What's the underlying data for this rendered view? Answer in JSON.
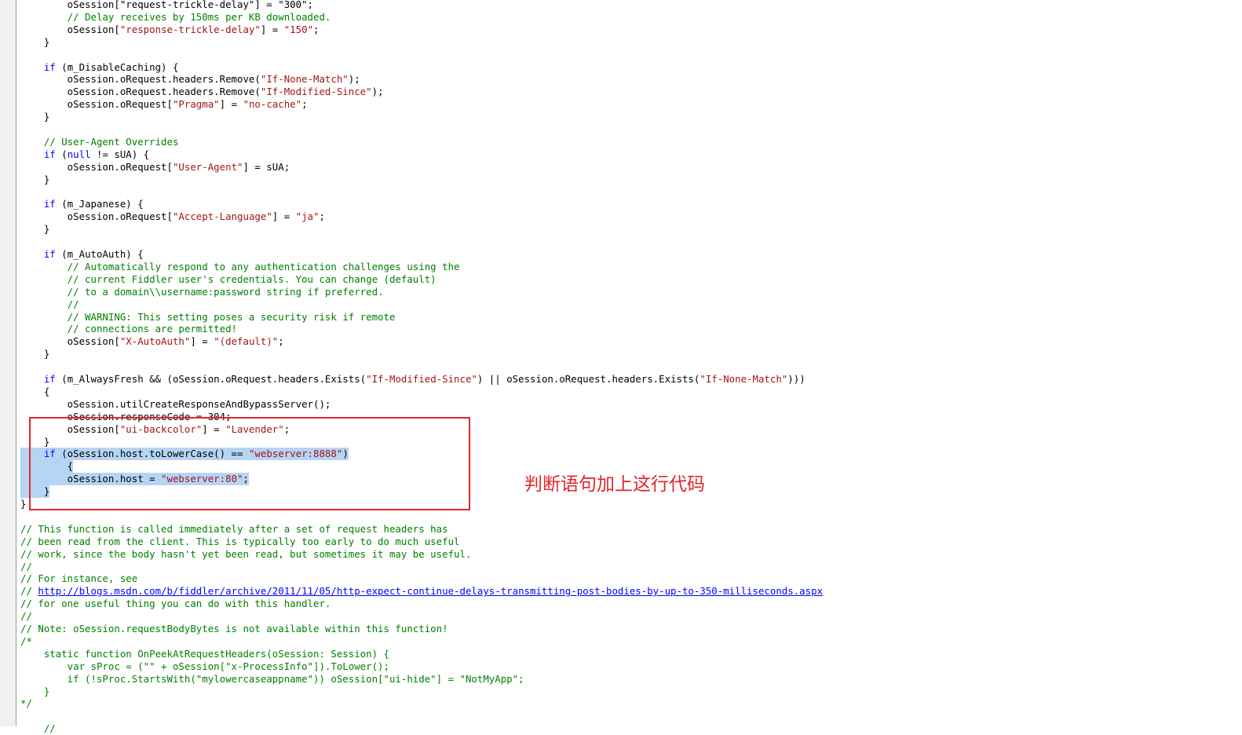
{
  "annotation": {
    "text": "判断语句加上这行代码",
    "box_color": "#e0262b"
  },
  "colors": {
    "keyword": "#0000ff",
    "string": "#a31515",
    "comment": "#008000",
    "selection": "#b6d4f4"
  },
  "code_lines": [
    {
      "segs": [
        [
          "p",
          "        oSession[\"request-trickle-delay\"] = \"300\";"
        ]
      ]
    },
    {
      "segs": [
        [
          "c",
          "        // Delay receives by 150ms per KB downloaded."
        ]
      ]
    },
    {
      "segs": [
        [
          "p",
          "        oSession["
        ],
        [
          "s",
          "\"response-trickle-delay\""
        ],
        [
          "p",
          "] = "
        ],
        [
          "s",
          "\"150\""
        ],
        [
          "p",
          ";"
        ]
      ]
    },
    {
      "segs": [
        [
          "p",
          "    }"
        ]
      ]
    },
    {
      "segs": []
    },
    {
      "segs": [
        [
          "k",
          "    if"
        ],
        [
          "p",
          " (m_DisableCaching) {"
        ]
      ]
    },
    {
      "segs": [
        [
          "p",
          "        oSession.oRequest.headers.Remove("
        ],
        [
          "s",
          "\"If-None-Match\""
        ],
        [
          "p",
          ");"
        ]
      ]
    },
    {
      "segs": [
        [
          "p",
          "        oSession.oRequest.headers.Remove("
        ],
        [
          "s",
          "\"If-Modified-Since\""
        ],
        [
          "p",
          ");"
        ]
      ]
    },
    {
      "segs": [
        [
          "p",
          "        oSession.oRequest["
        ],
        [
          "s",
          "\"Pragma\""
        ],
        [
          "p",
          "] = "
        ],
        [
          "s",
          "\"no-cache\""
        ],
        [
          "p",
          ";"
        ]
      ]
    },
    {
      "segs": [
        [
          "p",
          "    }"
        ]
      ]
    },
    {
      "segs": []
    },
    {
      "segs": [
        [
          "c",
          "    // User-Agent Overrides"
        ]
      ]
    },
    {
      "segs": [
        [
          "k",
          "    if"
        ],
        [
          "p",
          " ("
        ],
        [
          "k",
          "null"
        ],
        [
          "p",
          " != sUA) {"
        ]
      ]
    },
    {
      "segs": [
        [
          "p",
          "        oSession.oRequest["
        ],
        [
          "s",
          "\"User-Agent\""
        ],
        [
          "p",
          "] = sUA;"
        ]
      ]
    },
    {
      "segs": [
        [
          "p",
          "    }"
        ]
      ]
    },
    {
      "segs": []
    },
    {
      "segs": [
        [
          "k",
          "    if"
        ],
        [
          "p",
          " (m_Japanese) {"
        ]
      ]
    },
    {
      "segs": [
        [
          "p",
          "        oSession.oRequest["
        ],
        [
          "s",
          "\"Accept-Language\""
        ],
        [
          "p",
          "] = "
        ],
        [
          "s",
          "\"ja\""
        ],
        [
          "p",
          ";"
        ]
      ]
    },
    {
      "segs": [
        [
          "p",
          "    }"
        ]
      ]
    },
    {
      "segs": []
    },
    {
      "segs": [
        [
          "k",
          "    if"
        ],
        [
          "p",
          " (m_AutoAuth) {"
        ]
      ]
    },
    {
      "segs": [
        [
          "c",
          "        // Automatically respond to any authentication challenges using the"
        ]
      ]
    },
    {
      "segs": [
        [
          "c",
          "        // current Fiddler user's credentials. You can change (default)"
        ]
      ]
    },
    {
      "segs": [
        [
          "c",
          "        // to a domain\\\\username:password string if preferred."
        ]
      ]
    },
    {
      "segs": [
        [
          "c",
          "        //"
        ]
      ]
    },
    {
      "segs": [
        [
          "c",
          "        // WARNING: This setting poses a security risk if remote"
        ]
      ]
    },
    {
      "segs": [
        [
          "c",
          "        // connections are permitted!"
        ]
      ]
    },
    {
      "segs": [
        [
          "p",
          "        oSession["
        ],
        [
          "s",
          "\"X-AutoAuth\""
        ],
        [
          "p",
          "] = "
        ],
        [
          "s",
          "\"(default)\""
        ],
        [
          "p",
          ";"
        ]
      ]
    },
    {
      "segs": [
        [
          "p",
          "    }"
        ]
      ]
    },
    {
      "segs": []
    },
    {
      "segs": [
        [
          "k",
          "    if"
        ],
        [
          "p",
          " (m_AlwaysFresh && (oSession.oRequest.headers.Exists("
        ],
        [
          "s",
          "\"If-Modified-Since\""
        ],
        [
          "p",
          ") || oSession.oRequest.headers.Exists("
        ],
        [
          "s",
          "\"If-None-Match\""
        ],
        [
          "p",
          ")))"
        ]
      ]
    },
    {
      "segs": [
        [
          "p",
          "    {"
        ]
      ]
    },
    {
      "segs": [
        [
          "p",
          "        oSession.utilCreateResponseAndBypassServer();"
        ]
      ]
    },
    {
      "segs": [
        [
          "p",
          "        oSession.responseCode = 304;"
        ]
      ]
    },
    {
      "segs": [
        [
          "p",
          "        oSession["
        ],
        [
          "s",
          "\"ui-backcolor\""
        ],
        [
          "p",
          "] = "
        ],
        [
          "s",
          "\"Lavender\""
        ],
        [
          "p",
          ";"
        ]
      ]
    },
    {
      "segs": [
        [
          "p",
          "    }"
        ]
      ]
    },
    {
      "segs": [
        [
          "p",
          "    "
        ],
        [
          "k",
          "if"
        ],
        [
          "p",
          " (oSession.host.toLowerCase() == "
        ],
        [
          "s",
          "\"webserver:8888\""
        ],
        [
          "p",
          ")"
        ]
      ],
      "sel": true
    },
    {
      "segs": [
        [
          "p",
          "        {"
        ]
      ],
      "sel": true
    },
    {
      "segs": [
        [
          "p",
          "        oSession.host = "
        ],
        [
          "s",
          "\"webserver:80\""
        ],
        [
          "p",
          ";"
        ]
      ],
      "sel": true
    },
    {
      "segs": [
        [
          "p",
          "    }"
        ]
      ],
      "sel": true
    },
    {
      "segs": [
        [
          "p",
          "}"
        ]
      ]
    },
    {
      "segs": []
    },
    {
      "segs": [
        [
          "c",
          "// This function is called immediately after a set of request headers has"
        ]
      ]
    },
    {
      "segs": [
        [
          "c",
          "// been read from the client. This is typically too early to do much useful"
        ]
      ]
    },
    {
      "segs": [
        [
          "c",
          "// work, since the body hasn't yet been read, but sometimes it may be useful."
        ]
      ]
    },
    {
      "segs": [
        [
          "c",
          "//"
        ]
      ]
    },
    {
      "segs": [
        [
          "c",
          "// For instance, see"
        ]
      ]
    },
    {
      "segs": [
        [
          "c",
          "// "
        ],
        [
          "l",
          "http://blogs.msdn.com/b/fiddler/archive/2011/11/05/http-expect-continue-delays-transmitting-post-bodies-by-up-to-350-milliseconds.aspx"
        ]
      ]
    },
    {
      "segs": [
        [
          "c",
          "// for one useful thing you can do with this handler."
        ]
      ]
    },
    {
      "segs": [
        [
          "c",
          "//"
        ]
      ]
    },
    {
      "segs": [
        [
          "c",
          "// Note: oSession.requestBodyBytes is not available within this function!"
        ]
      ]
    },
    {
      "segs": [
        [
          "c",
          "/*"
        ]
      ]
    },
    {
      "segs": [
        [
          "c",
          "    static function OnPeekAtRequestHeaders(oSession: Session) {"
        ]
      ]
    },
    {
      "segs": [
        [
          "c",
          "        var sProc = (\"\" + oSession[\"x-ProcessInfo\"]).ToLower();"
        ]
      ]
    },
    {
      "segs": [
        [
          "c",
          "        if (!sProc.StartsWith(\"mylowercaseappname\")) oSession[\"ui-hide\"] = \"NotMyApp\";"
        ]
      ]
    },
    {
      "segs": [
        [
          "c",
          "    }"
        ]
      ]
    },
    {
      "segs": [
        [
          "c",
          "*/"
        ]
      ]
    },
    {
      "segs": []
    },
    {
      "segs": [
        [
          "c",
          "    //"
        ]
      ]
    }
  ]
}
